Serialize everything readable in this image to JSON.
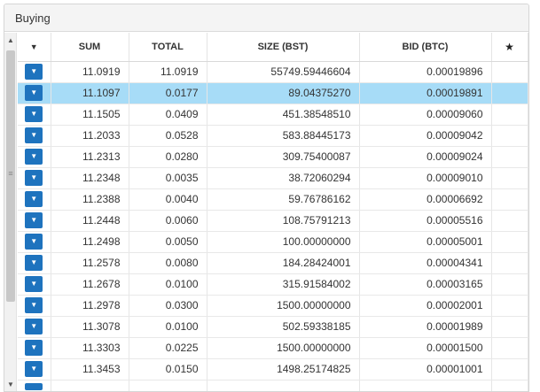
{
  "panel": {
    "title": "Buying"
  },
  "icons": {
    "row_button": "caret-down-icon",
    "header_sort": "caret-down-icon",
    "favorite": "star-icon"
  },
  "colors": {
    "button": "#1e73be",
    "selected_row": "#a7dcf7"
  },
  "table": {
    "columns": [
      "SUM",
      "TOTAL",
      "SIZE (BST)",
      "BID (BTC)"
    ],
    "selected_row_index": 1,
    "rows": [
      {
        "sum": "11.0919",
        "total": "11.0919",
        "size": "55749.59446604",
        "bid": "0.00019896"
      },
      {
        "sum": "11.1097",
        "total": "0.0177",
        "size": "89.04375270",
        "bid": "0.00019891"
      },
      {
        "sum": "11.1505",
        "total": "0.0409",
        "size": "451.38548510",
        "bid": "0.00009060"
      },
      {
        "sum": "11.2033",
        "total": "0.0528",
        "size": "583.88445173",
        "bid": "0.00009042"
      },
      {
        "sum": "11.2313",
        "total": "0.0280",
        "size": "309.75400087",
        "bid": "0.00009024"
      },
      {
        "sum": "11.2348",
        "total": "0.0035",
        "size": "38.72060294",
        "bid": "0.00009010"
      },
      {
        "sum": "11.2388",
        "total": "0.0040",
        "size": "59.76786162",
        "bid": "0.00006692"
      },
      {
        "sum": "11.2448",
        "total": "0.0060",
        "size": "108.75791213",
        "bid": "0.00005516"
      },
      {
        "sum": "11.2498",
        "total": "0.0050",
        "size": "100.00000000",
        "bid": "0.00005001"
      },
      {
        "sum": "11.2578",
        "total": "0.0080",
        "size": "184.28424001",
        "bid": "0.00004341"
      },
      {
        "sum": "11.2678",
        "total": "0.0100",
        "size": "315.91584002",
        "bid": "0.00003165"
      },
      {
        "sum": "11.2978",
        "total": "0.0300",
        "size": "1500.00000000",
        "bid": "0.00002001"
      },
      {
        "sum": "11.3078",
        "total": "0.0100",
        "size": "502.59338185",
        "bid": "0.00001989"
      },
      {
        "sum": "11.3303",
        "total": "0.0225",
        "size": "1500.00000000",
        "bid": "0.00001500"
      },
      {
        "sum": "11.3453",
        "total": "0.0150",
        "size": "1498.25174825",
        "bid": "0.00001001"
      }
    ]
  }
}
